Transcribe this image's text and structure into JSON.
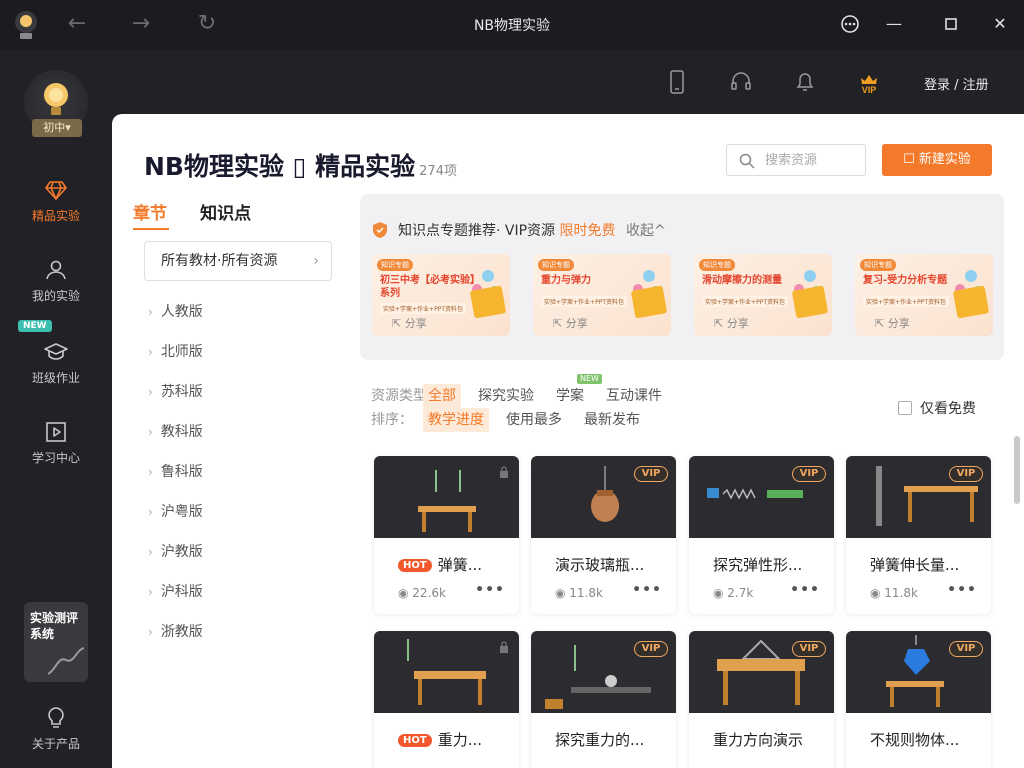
{
  "window": {
    "title": "NB物理实验"
  },
  "sidebar": {
    "level": "初中",
    "items": [
      {
        "label": "精品实验",
        "icon": "diamond-icon"
      },
      {
        "label": "我的实验",
        "icon": "user-icon"
      },
      {
        "label": "班级作业",
        "icon": "graduation-cap-icon",
        "badge": "NEW"
      },
      {
        "label": "学习中心",
        "icon": "play-box-icon"
      },
      {
        "label": "关于产品",
        "icon": "lightbulb-icon"
      }
    ],
    "eval_card": {
      "line1": "实验测评",
      "line2": "系统"
    }
  },
  "topbar": {
    "login": "登录 / 注册",
    "vip": "VIP"
  },
  "header": {
    "title": "NB物理实验 ▯ 精品实验",
    "count": "274项",
    "search_placeholder": "搜索资源",
    "new_button": "新建实验"
  },
  "chapters": {
    "tabs": [
      "章节",
      "知识点"
    ],
    "filter": "所有教材·所有资源",
    "editions": [
      "人教版",
      "北师版",
      "苏科版",
      "教科版",
      "鲁科版",
      "沪粤版",
      "沪教版",
      "沪科版",
      "浙教版"
    ]
  },
  "recommend": {
    "head": "知识点专题推荐· VIP资源",
    "free": "限时免费",
    "fold": "收起",
    "cards": [
      {
        "tag": "知识专题",
        "title": "初三中考【必考实验】系列",
        "sub": "实验+学案+作业+PPT资料包",
        "share": "分享"
      },
      {
        "tag": "知识专题",
        "title": "重力与弹力",
        "sub": "实验+学案+作业+PPT资料包",
        "share": "分享"
      },
      {
        "tag": "知识专题",
        "title": "滑动摩擦力的测量",
        "sub": "实验+学案+作业+PPT资料包",
        "share": "分享"
      },
      {
        "tag": "知识专题",
        "title": "复习-受力分析专题",
        "sub": "实验+学案+作业+PPT资料包",
        "share": "分享"
      }
    ]
  },
  "filters": {
    "type_label": "资源类型：",
    "types": [
      "全部",
      "探究实验",
      "学案",
      "互动课件"
    ],
    "new_tag": "NEW",
    "sort_label": "排序：",
    "sorts": [
      "教学进度",
      "使用最多",
      "最新发布"
    ],
    "free_only": "仅看免费"
  },
  "experiments": [
    {
      "title": "弹簧...",
      "hot": "HOT",
      "views": "22.6k",
      "badge": "lock"
    },
    {
      "title": "演示玻璃瓶...",
      "hot": "",
      "views": "11.8k",
      "badge": "VIP"
    },
    {
      "title": "探究弹性形...",
      "hot": "",
      "views": "2.7k",
      "badge": "VIP"
    },
    {
      "title": "弹簧伸长量...",
      "hot": "",
      "views": "11.8k",
      "badge": "VIP"
    },
    {
      "title": "重力...",
      "hot": "HOT",
      "views": "",
      "badge": "lock"
    },
    {
      "title": "探究重力的...",
      "hot": "",
      "views": "",
      "badge": "VIP"
    },
    {
      "title": "重力方向演示",
      "hot": "",
      "views": "",
      "badge": "VIP"
    },
    {
      "title": "不规则物体...",
      "hot": "",
      "views": "",
      "badge": "VIP"
    }
  ]
}
